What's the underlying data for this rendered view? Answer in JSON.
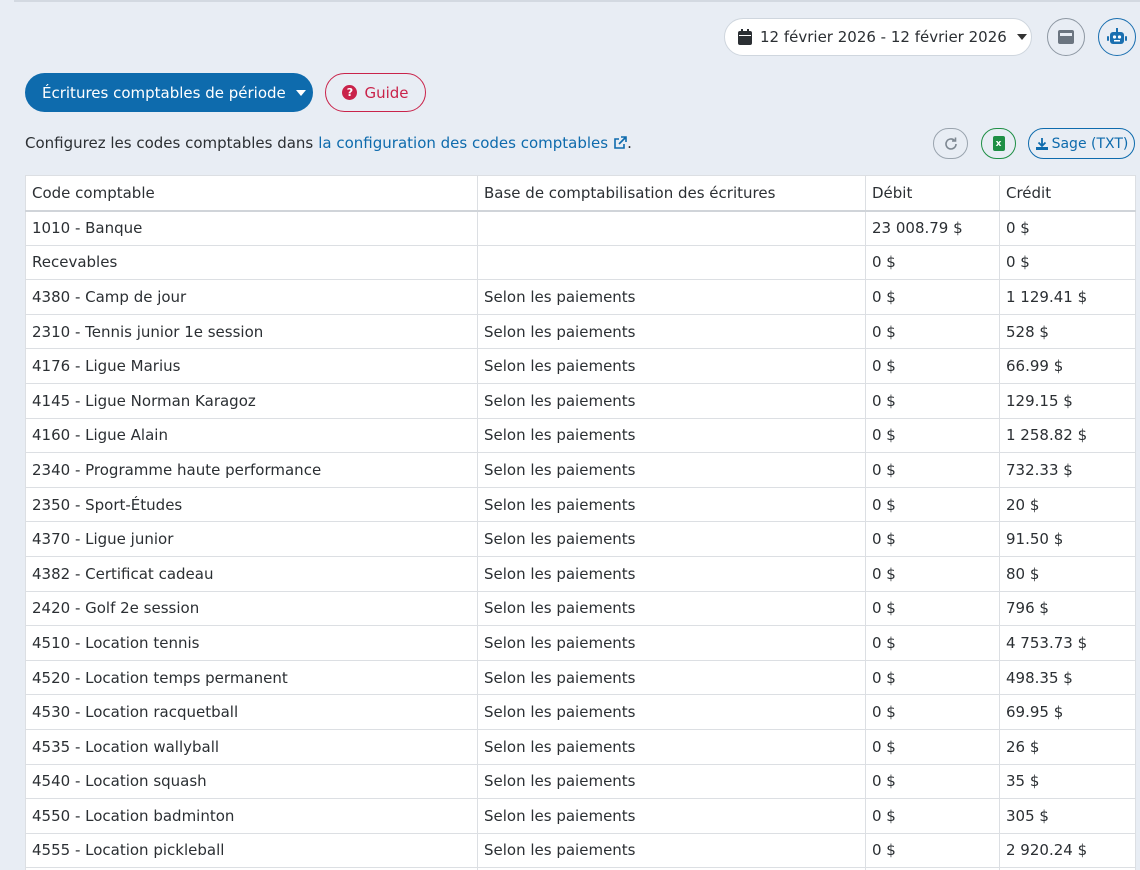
{
  "header": {
    "date_range": "12 février 2026 - 12 février 2026"
  },
  "actions": {
    "period_label": "Écritures comptables de période",
    "guide_label": "Guide",
    "sage_label": "Sage (TXT)"
  },
  "info": {
    "prefix": "Configurez les codes comptables dans",
    "link": "la configuration des codes comptables",
    "suffix": "."
  },
  "colors": {
    "primary": "#0e6bad",
    "guide": "#c9234a",
    "excel": "#1f8f45",
    "background": "#e8edf4"
  },
  "table": {
    "headers": [
      "Code comptable",
      "Base de comptabilisation des écritures",
      "Débit",
      "Crédit"
    ],
    "rows": [
      [
        "1010 - Banque",
        "",
        "23 008.79 $",
        "0 $"
      ],
      [
        "Recevables",
        "",
        "0 $",
        "0 $"
      ],
      [
        "4380 - Camp de jour",
        "Selon les paiements",
        "0 $",
        "1 129.41 $"
      ],
      [
        "2310 - Tennis junior 1e session",
        "Selon les paiements",
        "0 $",
        "528 $"
      ],
      [
        "4176 - Ligue Marius",
        "Selon les paiements",
        "0 $",
        "66.99 $"
      ],
      [
        "4145 - Ligue Norman Karagoz",
        "Selon les paiements",
        "0 $",
        "129.15 $"
      ],
      [
        "4160 - Ligue Alain",
        "Selon les paiements",
        "0 $",
        "1 258.82 $"
      ],
      [
        "2340 - Programme haute performance",
        "Selon les paiements",
        "0 $",
        "732.33 $"
      ],
      [
        "2350 - Sport-Études",
        "Selon les paiements",
        "0 $",
        "20 $"
      ],
      [
        "4370 - Ligue junior",
        "Selon les paiements",
        "0 $",
        "91.50 $"
      ],
      [
        "4382 - Certificat cadeau",
        "Selon les paiements",
        "0 $",
        "80 $"
      ],
      [
        "2420 - Golf 2e session",
        "Selon les paiements",
        "0 $",
        "796 $"
      ],
      [
        "4510 - Location tennis",
        "Selon les paiements",
        "0 $",
        "4 753.73 $"
      ],
      [
        "4520 - Location temps permanent",
        "Selon les paiements",
        "0 $",
        "498.35 $"
      ],
      [
        "4530 - Location racquetball",
        "Selon les paiements",
        "0 $",
        "69.95 $"
      ],
      [
        "4535 - Location wallyball",
        "Selon les paiements",
        "0 $",
        "26 $"
      ],
      [
        "4540 - Location squash",
        "Selon les paiements",
        "0 $",
        "35 $"
      ],
      [
        "4550 - Location badminton",
        "Selon les paiements",
        "0 $",
        "305 $"
      ],
      [
        "4555 - Location pickleball",
        "Selon les paiements",
        "0 $",
        "2 920.24 $"
      ],
      [
        "",
        "",
        "",
        ""
      ]
    ]
  }
}
